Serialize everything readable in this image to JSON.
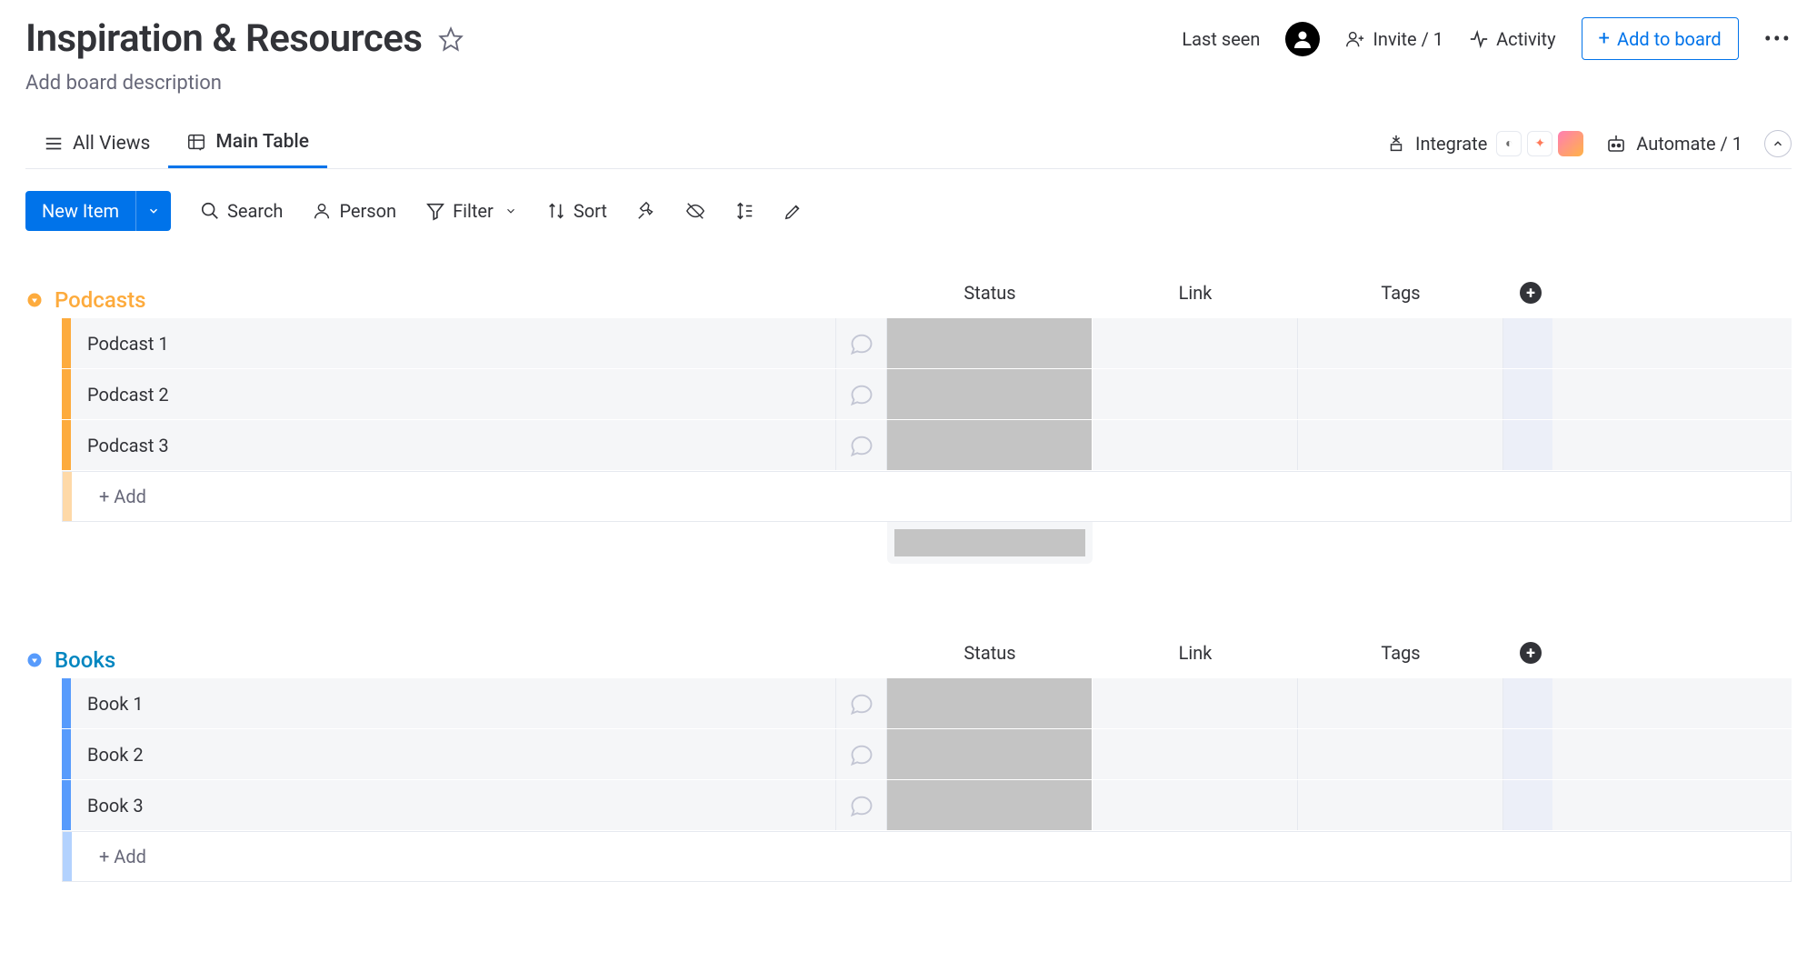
{
  "board": {
    "title": "Inspiration & Resources",
    "description": "Add board description"
  },
  "header": {
    "last_seen": "Last seen",
    "invite": "Invite / 1",
    "activity": "Activity",
    "add_to_board": "Add to board"
  },
  "tabs": {
    "all_views": "All Views",
    "main_table": "Main Table"
  },
  "integrations": {
    "integrate": "Integrate",
    "automate": "Automate / 1"
  },
  "toolbar": {
    "new_item": "New Item",
    "search": "Search",
    "person": "Person",
    "filter": "Filter",
    "sort": "Sort"
  },
  "columns": {
    "status": "Status",
    "link": "Link",
    "tags": "Tags"
  },
  "add_row": "+ Add",
  "groups": [
    {
      "name": "Podcasts",
      "color": "orange",
      "items": [
        {
          "name": "Podcast 1"
        },
        {
          "name": "Podcast 2"
        },
        {
          "name": "Podcast 3"
        }
      ]
    },
    {
      "name": "Books",
      "color": "blue",
      "items": [
        {
          "name": "Book 1"
        },
        {
          "name": "Book 2"
        },
        {
          "name": "Book 3"
        }
      ]
    }
  ]
}
